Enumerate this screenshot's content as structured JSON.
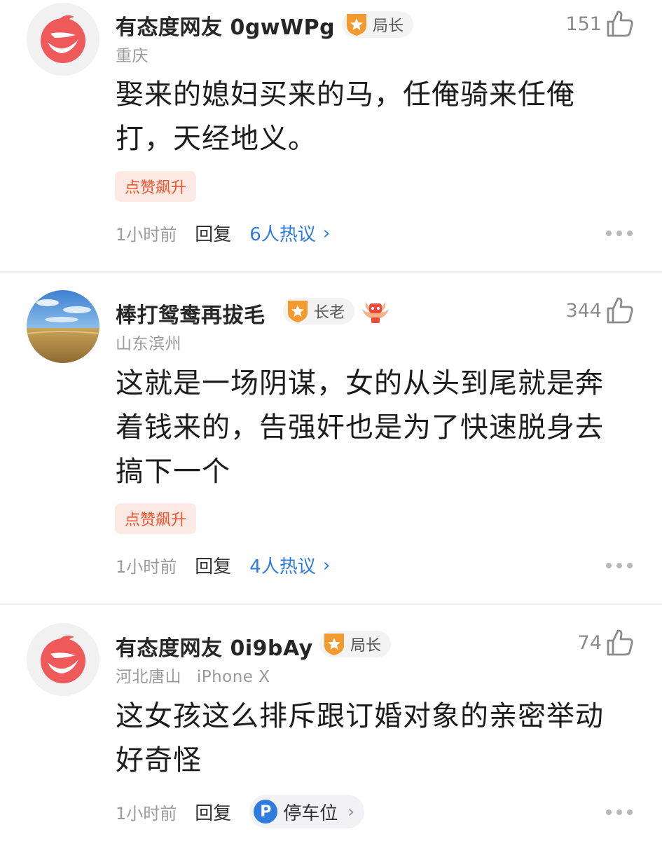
{
  "comments": [
    {
      "username": "有态度网友 0gwWPg",
      "rank": "局长",
      "location": "重庆",
      "likes": "151",
      "text": "娶来的媳妇买来的马，任俺骑来任俺打，天经地义。",
      "tag": "点赞飙升",
      "time": "1小时前",
      "reply": "回复",
      "discussion": "6人热议"
    },
    {
      "username": "棒打鸳鸯再拔毛",
      "rank": "长老",
      "location": "山东滨州",
      "likes": "344",
      "text": "这就是一场阴谋，女的从头到尾就是奔着钱来的，告强奸也是为了快速脱身去搞下一个",
      "tag": "点赞飙升",
      "time": "1小时前",
      "reply": "回复",
      "discussion": "4人热议"
    },
    {
      "username": "有态度网友 0i9bAy",
      "rank": "局长",
      "location": "河北唐山",
      "device": "iPhone X",
      "likes": "74",
      "text": "这女孩这么排斥跟订婚对象的亲密举动 好奇怪",
      "time": "1小时前",
      "reply": "回复",
      "topic": "停车位"
    }
  ],
  "icons": {
    "avatar_default": "netease-logo-avatar",
    "avatar_photo": "wheat-field-avatar",
    "rank_badge": "star-shield-icon",
    "medal": "wings-medal-icon",
    "like": "thumbs-up-icon",
    "more": "more-dots-icon",
    "chevron": "chevron-right-icon",
    "parking": "parking-icon"
  },
  "colors": {
    "accent_blue": "#2f7be0",
    "hot_tag_bg": "#fde9e3",
    "hot_tag_text": "#f2542f",
    "badge_orange": "#f29a2e"
  }
}
